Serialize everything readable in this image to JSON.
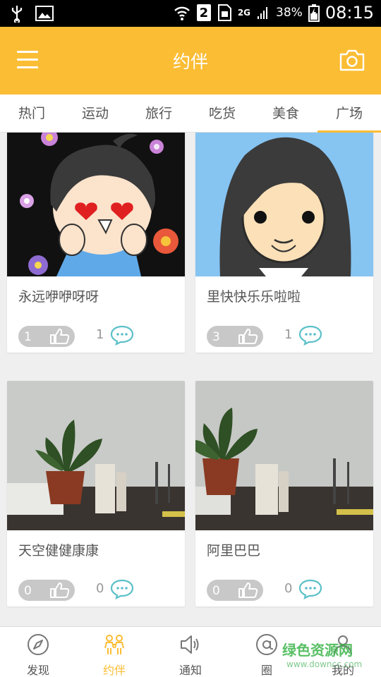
{
  "status_bar": {
    "sim_badge": "2",
    "network": "2G",
    "battery": "38%",
    "time": "08:15"
  },
  "header": {
    "title": "约伴"
  },
  "tabs": [
    {
      "label": "热门",
      "active": false
    },
    {
      "label": "运动",
      "active": false
    },
    {
      "label": "旅行",
      "active": false
    },
    {
      "label": "吃货",
      "active": false
    },
    {
      "label": "美食",
      "active": false
    },
    {
      "label": "广场",
      "active": true
    }
  ],
  "cards": [
    {
      "name": "永远咿咿呀呀",
      "likes": "1",
      "comments": "1",
      "image": "cartoon-boy-avatar"
    },
    {
      "name": "里快快乐乐啦啦",
      "likes": "3",
      "comments": "1",
      "image": "cartoon-girl-avatar"
    },
    {
      "name": "天空健健康康",
      "likes": "0",
      "comments": "0",
      "image": "potted-plant-photo"
    },
    {
      "name": "阿里巴巴",
      "likes": "0",
      "comments": "0",
      "image": "potted-plant-photo"
    }
  ],
  "bottom_nav": [
    {
      "label": "发现",
      "icon": "compass-icon",
      "active": false
    },
    {
      "label": "约伴",
      "icon": "companions-icon",
      "active": true
    },
    {
      "label": "通知",
      "icon": "speaker-icon",
      "active": false
    },
    {
      "label": "圈",
      "icon": "at-sign-icon",
      "active": false
    },
    {
      "label": "我的",
      "icon": "user-icon",
      "active": false
    }
  ],
  "watermark": {
    "text": "绿色资源网",
    "url": "www.downcc.com"
  },
  "colors": {
    "accent": "#fbbd34",
    "comment_icon": "#5bc0c8",
    "like_pill": "#c8c8c8"
  }
}
